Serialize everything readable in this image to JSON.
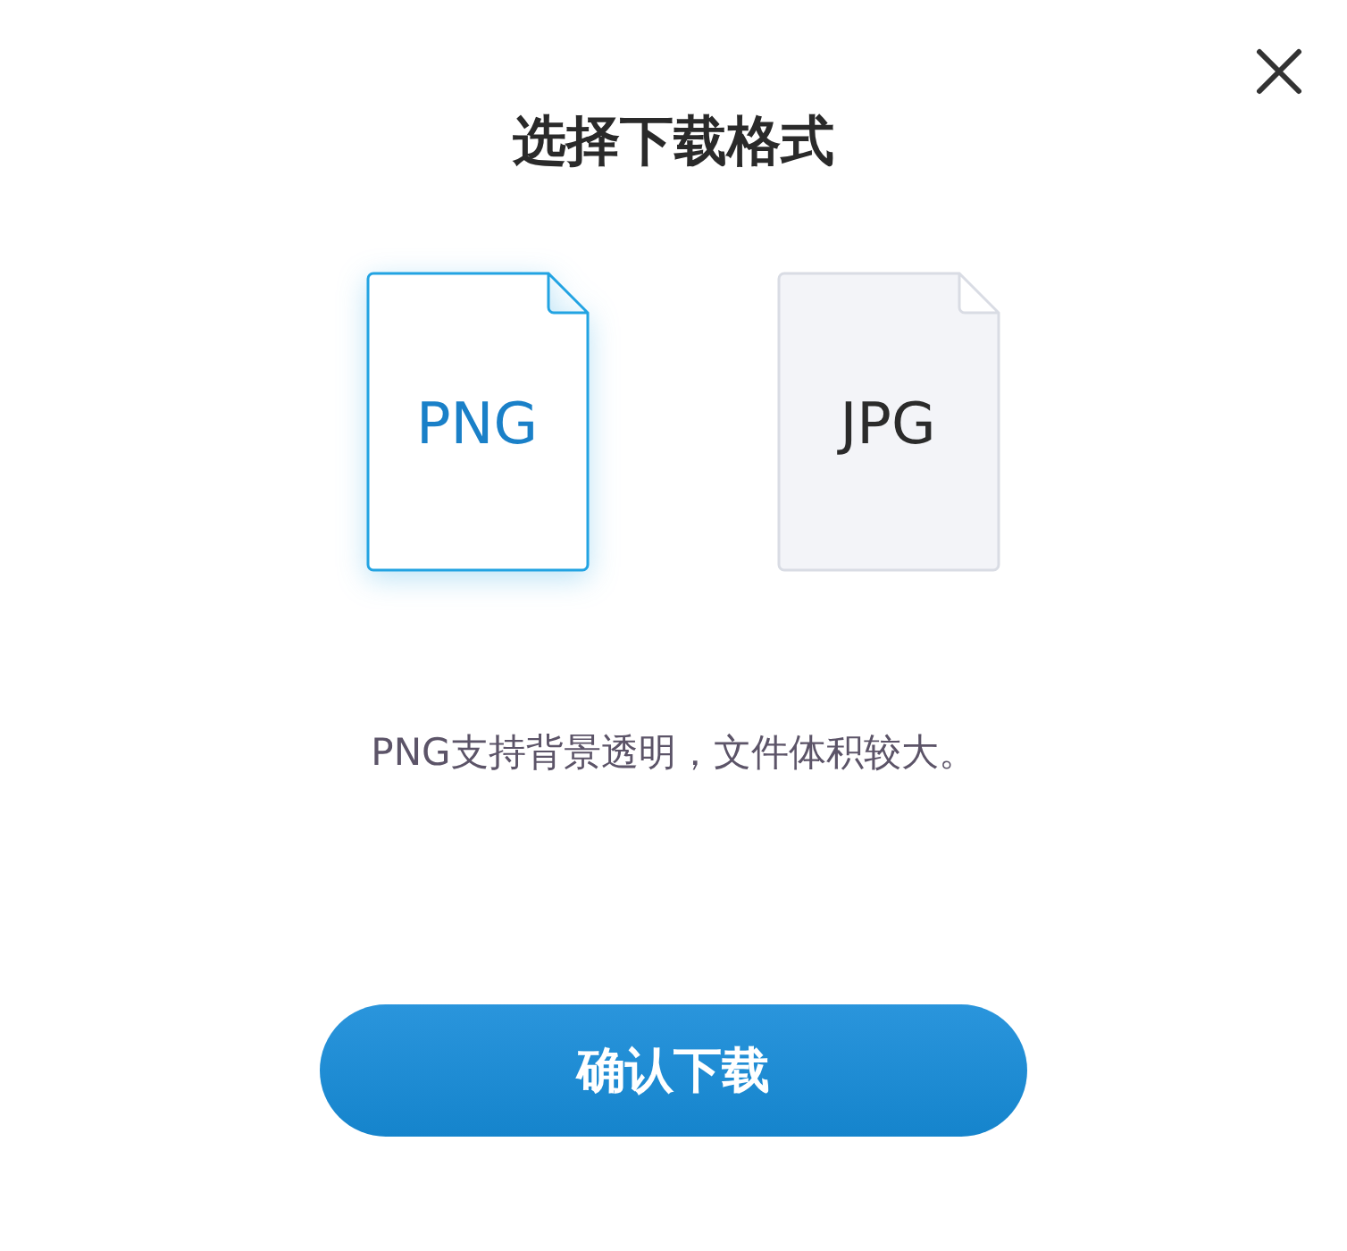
{
  "dialog": {
    "title": "选择下载格式",
    "formats": [
      {
        "label": "PNG",
        "selected": true
      },
      {
        "label": "JPG",
        "selected": false
      }
    ],
    "description": "PNG支持背景透明，文件体积较大。",
    "confirm_button": "确认下载"
  }
}
